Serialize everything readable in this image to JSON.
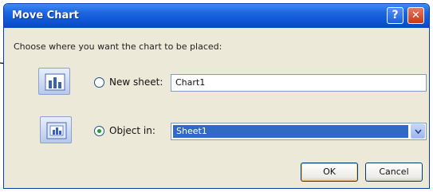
{
  "window": {
    "title": "Move Chart",
    "help_glyph": "?",
    "close_glyph": "✕"
  },
  "instruction": "Choose where you want the chart to be placed:",
  "options": [
    {
      "label": "New sheet:",
      "selected": false,
      "value": "Chart1",
      "icon": "new-sheet-chart-icon"
    },
    {
      "label": "Object in:",
      "selected": true,
      "value": "Sheet1",
      "icon": "embedded-chart-icon"
    }
  ],
  "buttons": {
    "ok": "OK",
    "cancel": "Cancel"
  },
  "colors": {
    "titlebar": "#0f56d6",
    "dialog_bg": "#ece9d8",
    "selection": "#316ac5"
  }
}
